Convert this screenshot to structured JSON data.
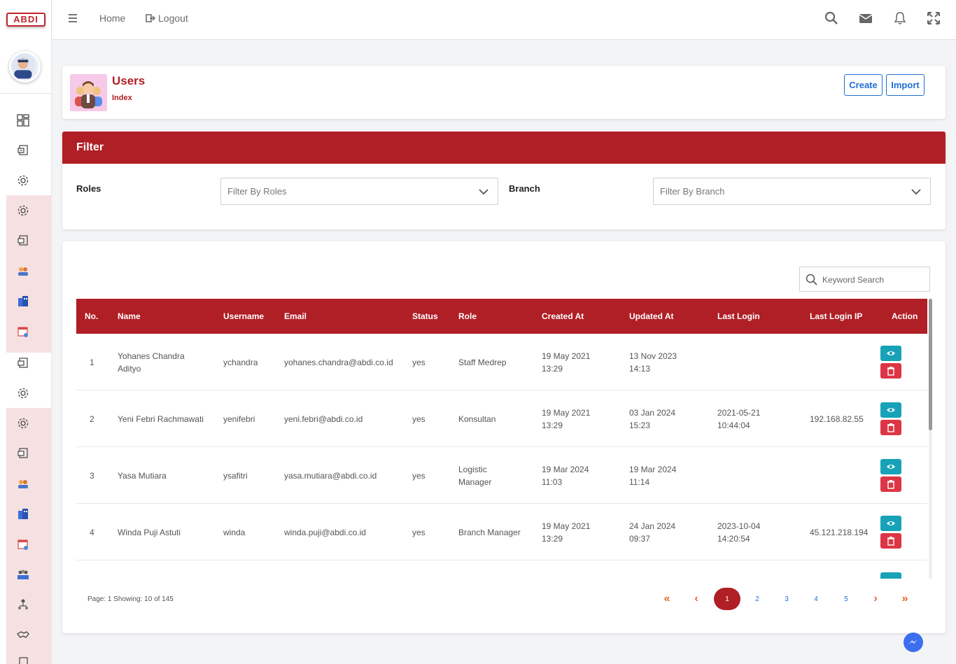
{
  "brand": {
    "logo_text": "ABDI"
  },
  "topbar": {
    "home_label": "Home",
    "logout_label": "Logout",
    "icons": [
      "menu-icon",
      "search-icon",
      "mail-icon",
      "bell-icon",
      "fullscreen-icon"
    ]
  },
  "sidebar": {
    "icons": [
      "dashboard-icon",
      "document-icon",
      "gear-icon",
      "gear-icon",
      "document-icon",
      "users-icon",
      "building-icon",
      "calendar-icon",
      "document-icon",
      "gear-icon",
      "gear-icon",
      "document-icon",
      "users-icon",
      "building-icon",
      "calendar-icon",
      "team-icon",
      "org-icon",
      "handshake-icon"
    ]
  },
  "header": {
    "title": "Users",
    "subtitle": "Index",
    "create_label": "Create",
    "import_label": "Import"
  },
  "filter": {
    "title": "Filter",
    "roles_label": "Roles",
    "roles_placeholder": "Filter By Roles",
    "branch_label": "Branch",
    "branch_placeholder": "Filter By Branch"
  },
  "search": {
    "placeholder": "Keyword Search"
  },
  "table": {
    "columns": [
      "No.",
      "Name",
      "Username",
      "Email",
      "Status",
      "Role",
      "Created At",
      "Updated At",
      "Last Login",
      "Last Login IP",
      "Action"
    ],
    "rows": [
      {
        "no": "1",
        "name": [
          "Yohanes Chandra",
          "Adityo"
        ],
        "username": "ychandra",
        "email": "yohanes.chandra@abdi.co.id",
        "status": "yes",
        "role": [
          "Staff Medrep"
        ],
        "created": [
          "19 May 2021",
          "13:29"
        ],
        "updated": [
          "13 Nov 2023",
          "14:13"
        ],
        "last_login": [],
        "ip": ""
      },
      {
        "no": "2",
        "name": [
          "Yeni Febri Rachmawati"
        ],
        "username": "yenifebri",
        "email": "yeni.febri@abdi.co.id",
        "status": "yes",
        "role": [
          "Konsultan"
        ],
        "created": [
          "19 May 2021",
          "13:29"
        ],
        "updated": [
          "03 Jan 2024",
          "15:23"
        ],
        "last_login": [
          "2021-05-21",
          "10:44:04"
        ],
        "ip": "192.168.82.55"
      },
      {
        "no": "3",
        "name": [
          "Yasa Mutiara"
        ],
        "username": "ysafitri",
        "email": "yasa.mutiara@abdi.co.id",
        "status": "yes",
        "role": [
          "Logistic",
          "Manager"
        ],
        "created": [
          "19 Mar 2024",
          "11:03"
        ],
        "updated": [
          "19 Mar 2024",
          "11:14"
        ],
        "last_login": [],
        "ip": ""
      },
      {
        "no": "4",
        "name": [
          "Winda Puji Astuti"
        ],
        "username": "winda",
        "email": "winda.puji@abdi.co.id",
        "status": "yes",
        "role": [
          "Branch Manager"
        ],
        "created": [
          "19 May 2021",
          "13:29"
        ],
        "updated": [
          "24 Jan 2024",
          "09:37"
        ],
        "last_login": [
          "2023-10-04",
          "14:20:54"
        ],
        "ip": "45.121.218.194"
      }
    ]
  },
  "pagination": {
    "info": "Page: 1 Showing: 10 of 145",
    "first": "«",
    "prev": "‹",
    "pages": [
      "1",
      "2",
      "3",
      "4",
      "5"
    ],
    "current": "1",
    "next": "›",
    "last": "»"
  },
  "colors": {
    "primary": "#b01e26",
    "link": "#1f6ed4",
    "view": "#17a2b8",
    "delete": "#dc3545",
    "sidebar_group": "#f6e1e2"
  }
}
